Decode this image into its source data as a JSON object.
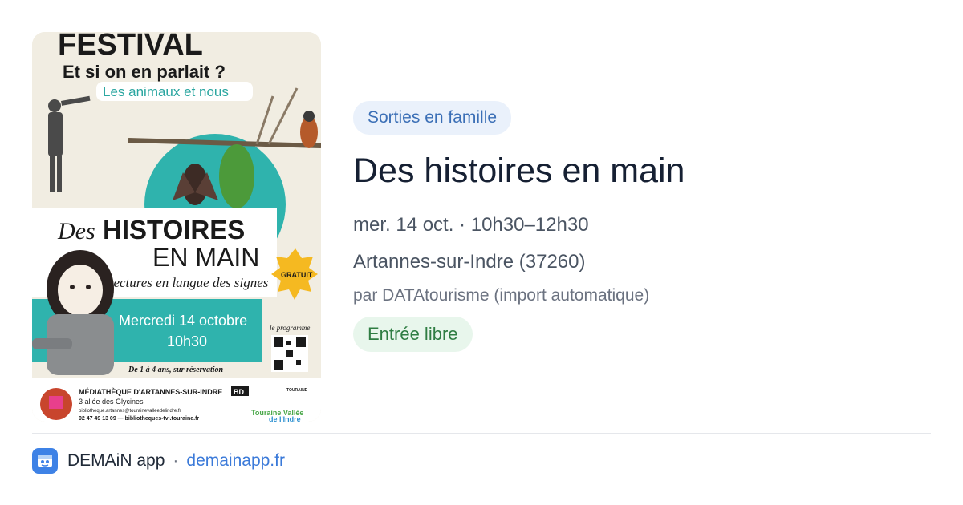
{
  "poster": {
    "festival": "FESTIVAL",
    "subtitle": "Et si on en parlait ?",
    "theme": "Les animaux et nous",
    "title_des": "Des",
    "title_histoires": "HISTOIRES",
    "title_en_main": "EN MAIN",
    "tagline": "Lectures en langue des signes",
    "gratuit": "GRATUIT",
    "date": "Mercredi 14 octobre",
    "time": "10h30",
    "programme": "le programme",
    "audience": "De 1 à 4 ans, sur réservation",
    "library": "MÉDIATHÈQUE D'ARTANNES-SUR-INDRE",
    "address": "3 allée des Glycines",
    "email": "bibliotheque.artannes@tourainevalleedelindre.fr",
    "phone": "02 47 49 13 09 — bibliotheques-tvi.touraine.fr",
    "logo_bd": "BD",
    "logo_touraine": "TOURAINE",
    "logo_tvi_1": "Touraine Vallée",
    "logo_tvi_2": "de l'Indre"
  },
  "event": {
    "category": "Sorties en famille",
    "title": "Des histoires en main",
    "datetime": "mer. 14 oct. · 10h30–12h30",
    "location": "Artannes-sur-Indre (37260)",
    "source": "par DATAtourisme (import automatique)",
    "price": "Entrée libre"
  },
  "footer": {
    "app_name": "DEMAiN app",
    "separator": "·",
    "site": "demainapp.fr"
  },
  "colors": {
    "accent_blue": "#3b7ad9",
    "category_bg": "#eaf1fb",
    "price_bg": "#e8f6ec",
    "price_text": "#2f7d43",
    "poster_teal": "#2fb3ad"
  },
  "icons": [
    "app-logo-icon"
  ]
}
